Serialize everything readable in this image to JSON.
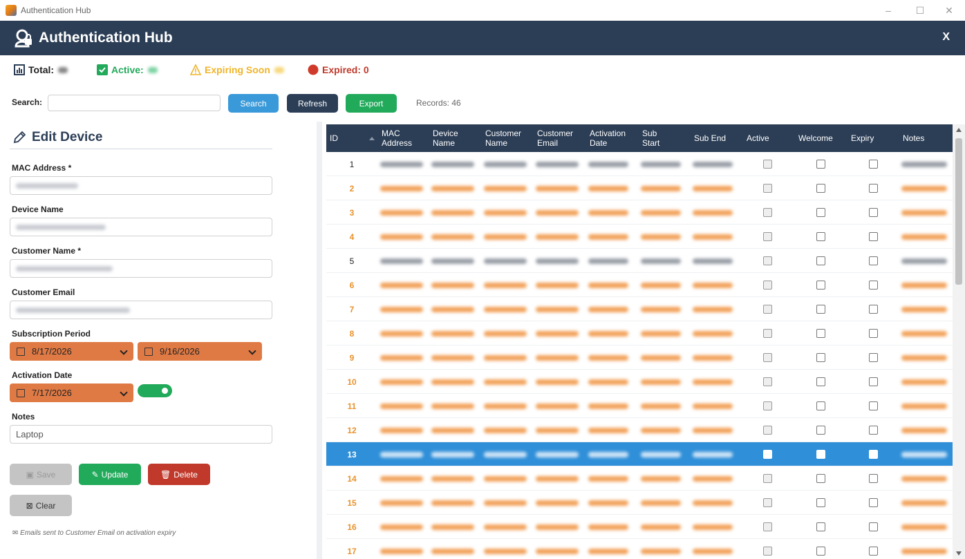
{
  "window": {
    "title": "Authentication Hub",
    "controls": [
      "–",
      "☐",
      "✕"
    ]
  },
  "header": {
    "title": "Authentication Hub",
    "close_label": "X"
  },
  "stats": {
    "total_label": "Total:",
    "active_label": "Active:",
    "expiring_label": "Expiring Soon",
    "expired_label": "Expired: 0",
    "colors": {
      "total": "#222222",
      "active": "#22aa5b",
      "expiring": "#f0b429",
      "expired": "#c0392b"
    }
  },
  "search": {
    "label": "Search:",
    "placeholder": "",
    "search_button": "Search",
    "refresh_button": "Refresh",
    "export_button": "Export",
    "records": "Records: 46"
  },
  "form": {
    "title": "Edit Device",
    "mac_label": "MAC Address *",
    "device_label": "Device Name",
    "customer_label": "Customer Name *",
    "email_label": "Customer Email",
    "period_label": "Subscription Period",
    "sub_start": "8/17/2026",
    "sub_end": "9/16/2026",
    "activation_label": "Activation Date",
    "activation_date": "7/17/2026",
    "activation_enabled": true,
    "notes_label": "Notes",
    "notes_value": "Laptop",
    "save_button": "Save",
    "update_button": "Update",
    "delete_button": "Delete",
    "clear_button": "Clear",
    "footnote": "Emails sent to Customer Email on activation  expiry"
  },
  "grid": {
    "columns": [
      {
        "label": "ID"
      },
      {
        "label": "MAC Address"
      },
      {
        "label": "Device Name"
      },
      {
        "label": "Customer Name"
      },
      {
        "label": "Customer Email"
      },
      {
        "label": "Activation Date"
      },
      {
        "label": "Sub Start"
      },
      {
        "label": "Sub End"
      },
      {
        "label": "Active"
      },
      {
        "label": "Welcome"
      },
      {
        "label": "Expiry"
      },
      {
        "label": "Notes"
      }
    ],
    "rows": [
      {
        "id": "1",
        "style": "black",
        "active": true,
        "welcome": false,
        "expiry": false
      },
      {
        "id": "2",
        "style": "orange",
        "active": true,
        "welcome": false,
        "expiry": false
      },
      {
        "id": "3",
        "style": "orange",
        "active": true,
        "welcome": false,
        "expiry": false
      },
      {
        "id": "4",
        "style": "orange",
        "active": true,
        "welcome": false,
        "expiry": false
      },
      {
        "id": "5",
        "style": "black",
        "active": true,
        "welcome": false,
        "expiry": false
      },
      {
        "id": "6",
        "style": "orange",
        "active": true,
        "welcome": false,
        "expiry": false
      },
      {
        "id": "7",
        "style": "orange",
        "active": true,
        "welcome": false,
        "expiry": false
      },
      {
        "id": "8",
        "style": "orange",
        "active": true,
        "welcome": false,
        "expiry": false
      },
      {
        "id": "9",
        "style": "orange",
        "active": true,
        "welcome": false,
        "expiry": false
      },
      {
        "id": "10",
        "style": "orange",
        "active": true,
        "welcome": false,
        "expiry": false
      },
      {
        "id": "11",
        "style": "orange",
        "active": true,
        "welcome": false,
        "expiry": false
      },
      {
        "id": "12",
        "style": "orange",
        "active": true,
        "welcome": false,
        "expiry": false
      },
      {
        "id": "13",
        "style": "sel",
        "active": true,
        "welcome": false,
        "expiry": false
      },
      {
        "id": "14",
        "style": "orange",
        "active": true,
        "welcome": false,
        "expiry": false
      },
      {
        "id": "15",
        "style": "orange",
        "active": true,
        "welcome": false,
        "expiry": false
      },
      {
        "id": "16",
        "style": "orange",
        "active": true,
        "welcome": false,
        "expiry": false
      },
      {
        "id": "17",
        "style": "orange",
        "active": true,
        "welcome": false,
        "expiry": false
      }
    ]
  },
  "colors": {
    "header_bg": "#2c3e56",
    "orange_row": "#e8932e",
    "selected_row": "#2f8fd8",
    "date_picker": "#e07a45",
    "search_btn": "#3a9ad9",
    "refresh_btn": "#2c3e56",
    "export_btn": "#22aa5b",
    "delete_btn": "#c0392b"
  }
}
